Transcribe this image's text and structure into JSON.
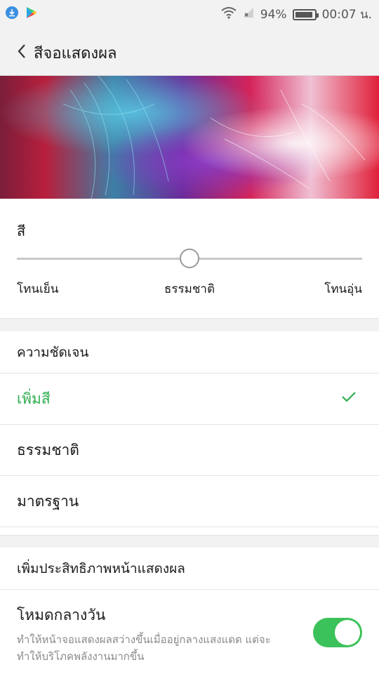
{
  "status_bar": {
    "battery_percent": "94%",
    "battery_level": 0.94,
    "time": "00:07 น.",
    "icons": [
      "download-icon",
      "play-store-icon",
      "wifi-icon",
      "signal-icon",
      "battery-icon"
    ]
  },
  "app_bar": {
    "title": "สีจอแสดงผล",
    "back_icon": "chevron-left-icon"
  },
  "color_temperature": {
    "label": "สี",
    "slider_value": 0.5,
    "left_label": "โทนเย็น",
    "middle_label": "ธรรมชาติ",
    "right_label": "โทนอุ่น"
  },
  "clarity": {
    "header": "ความชัดเจน",
    "options": [
      {
        "label": "เพิ่มสี",
        "selected": true
      },
      {
        "label": "ธรรมชาติ",
        "selected": false
      },
      {
        "label": "มาตรฐาน",
        "selected": false
      }
    ],
    "check_icon": "checkmark-icon"
  },
  "display_enhance": {
    "header": "เพิ่มประสิทธิภาพหน้าแสดงผล",
    "day_mode": {
      "title": "โหมดกลางวัน",
      "description": "ทำให้หน้าจอแสดงผลสว่างขึ้นเมื่ออยู่กลางแสงแดด แต่จะทำให้บริโภคพลังงานมากขึ้น",
      "enabled": true
    }
  },
  "colors": {
    "accent_green": "#2fae4f",
    "toggle_green": "#3cc25a",
    "bar_background": "#f2f2f2"
  }
}
